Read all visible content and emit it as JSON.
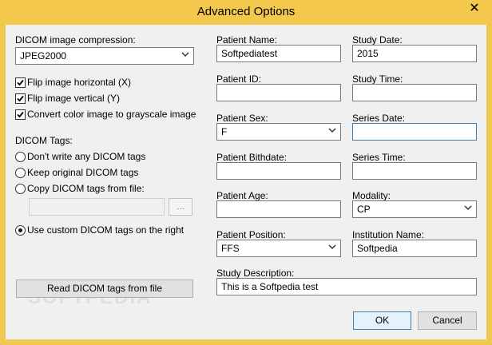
{
  "window": {
    "title": "Advanced Options",
    "close_glyph": "✕"
  },
  "compression": {
    "label": "DICOM image compression:",
    "value": "JPEG2000"
  },
  "options": {
    "flip_horizontal": "Flip image horizontal (X)",
    "flip_vertical": "Flip image vertical (Y)",
    "grayscale": "Convert color image to grayscale image"
  },
  "dicom_tags": {
    "label": "DICOM Tags:",
    "dont_write": "Don't write any DICOM tags",
    "keep_original": "Keep original DICOM tags",
    "copy_from_file": "Copy DICOM tags from file:",
    "browse_label": "...",
    "use_custom": "Use custom DICOM tags on the right"
  },
  "read_button": "Read DICOM tags from file",
  "watermark": "SOFTPEDIA",
  "patient": {
    "name_label": "Patient Name:",
    "name_value": "Softpediatest",
    "id_label": "Patient ID:",
    "id_value": "",
    "sex_label": "Patient Sex:",
    "sex_value": "F",
    "birthdate_label": "Patient Bithdate:",
    "birthdate_value": "",
    "age_label": "Patient Age:",
    "age_value": "",
    "position_label": "Patient Position:",
    "position_value": "FFS"
  },
  "study": {
    "date_label": "Study Date:",
    "date_value": "2015",
    "time_label": "Study Time:",
    "time_value": "",
    "description_label": "Study Description:",
    "description_value": "This is a Softpedia test"
  },
  "series": {
    "date_label": "Series Date:",
    "date_value": "",
    "time_label": "Series Time:",
    "time_value": ""
  },
  "modality": {
    "label": "Modality:",
    "value": "CP"
  },
  "institution": {
    "label": "Institution Name:",
    "value": "Softpedia"
  },
  "buttons": {
    "ok": "OK",
    "cancel": "Cancel"
  }
}
